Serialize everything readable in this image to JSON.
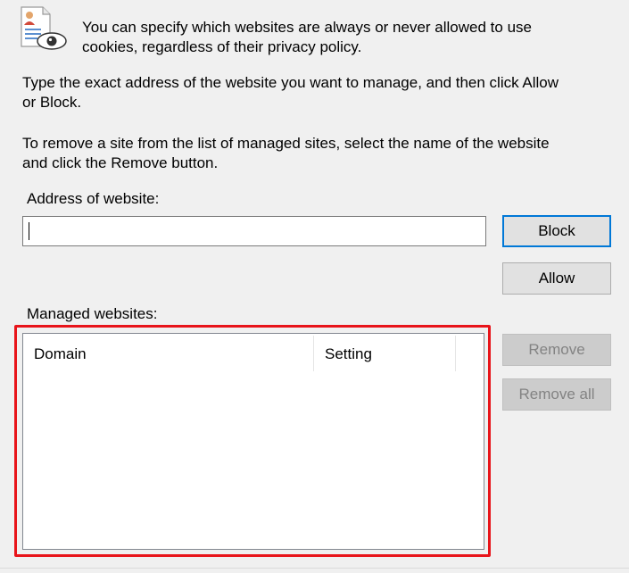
{
  "cutoff_text": "",
  "intro": {
    "icon": "privacy-document-eye-icon",
    "text_line1": "You can specify which websites are always or never allowed to use",
    "text_line2": "cookies, regardless of their privacy policy."
  },
  "instructions": {
    "manage_line1": "Type the exact address of the website you want to manage, and then click Allow",
    "manage_line2": "or Block.",
    "remove_line1": "To remove a site from the list of managed sites, select the name of the website",
    "remove_line2": "and click the Remove button."
  },
  "address": {
    "label": "Address of website:",
    "value": ""
  },
  "buttons": {
    "block": "Block",
    "allow": "Allow",
    "remove": "Remove",
    "remove_all": "Remove all"
  },
  "managed": {
    "label": "Managed websites:",
    "columns": [
      "Domain",
      "Setting"
    ],
    "rows": []
  },
  "colors": {
    "highlight": "#e8141a",
    "focus_accent": "#0078d7",
    "background": "#f0f0f0"
  }
}
